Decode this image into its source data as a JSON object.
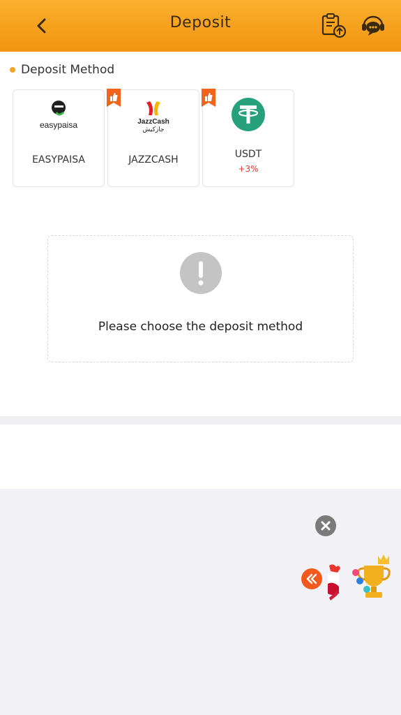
{
  "header": {
    "title": "Deposit",
    "back_icon": "chevron-left-icon",
    "record_icon": "clipboard-upload-icon",
    "support_icon": "chat-support-icon"
  },
  "section": {
    "title": "Deposit Method"
  },
  "methods": [
    {
      "label": "EASYPAISA",
      "logo_text": "easypaisa",
      "recommended": false
    },
    {
      "label": "JAZZCASH",
      "logo_text": "JazzCash",
      "logo_subtext": "جازکیش",
      "recommended": true
    },
    {
      "label": "USDT",
      "bonus": "+3%",
      "recommended": true
    }
  ],
  "empty_state": {
    "message": "Please choose the deposit method"
  },
  "colors": {
    "accent": "#f5a21e",
    "header_top": "#f9b02e",
    "header_bottom": "#f39410",
    "usdt_green": "#26a17b",
    "bonus_red": "#e23b30"
  }
}
